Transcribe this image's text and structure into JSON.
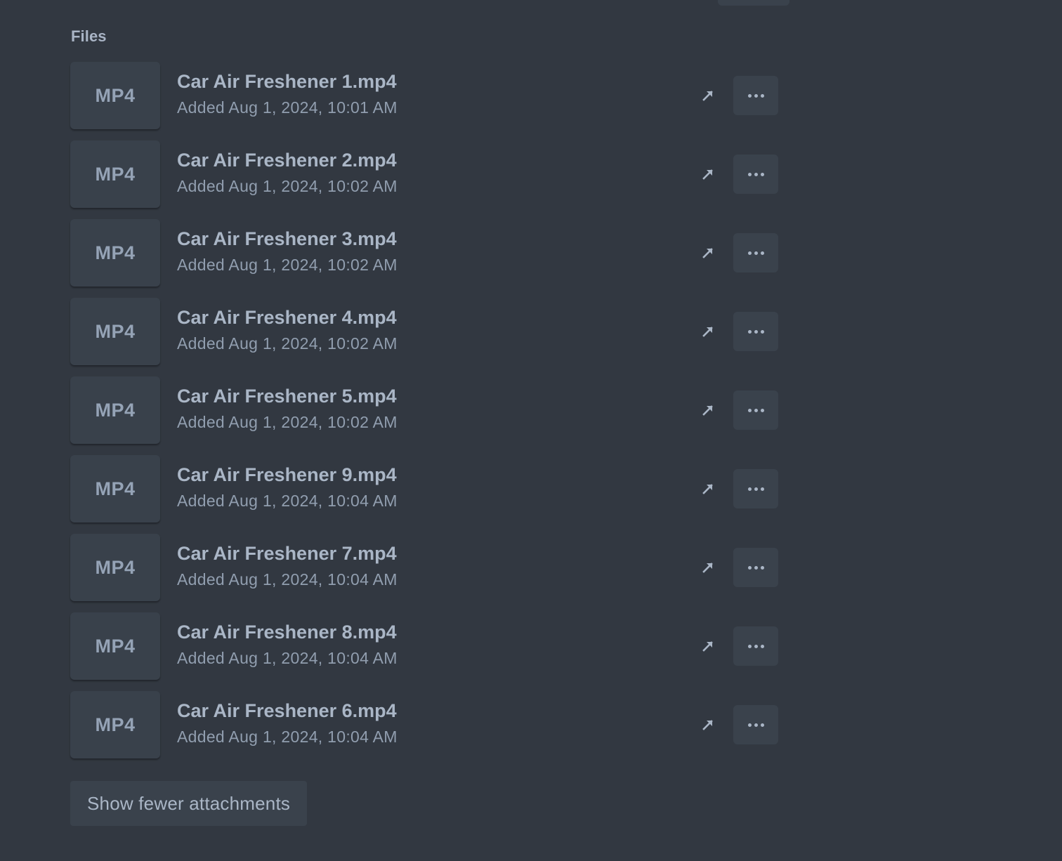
{
  "section": {
    "title": "Files"
  },
  "files": [
    {
      "type_label": "MP4",
      "name": "Car Air Freshener 1.mp4",
      "added": "Added Aug 1, 2024, 10:01 AM"
    },
    {
      "type_label": "MP4",
      "name": "Car Air Freshener 2.mp4",
      "added": "Added Aug 1, 2024, 10:02 AM"
    },
    {
      "type_label": "MP4",
      "name": "Car Air Freshener 3.mp4",
      "added": "Added Aug 1, 2024, 10:02 AM"
    },
    {
      "type_label": "MP4",
      "name": "Car Air Freshener 4.mp4",
      "added": "Added Aug 1, 2024, 10:02 AM"
    },
    {
      "type_label": "MP4",
      "name": "Car Air Freshener 5.mp4",
      "added": "Added Aug 1, 2024, 10:02 AM"
    },
    {
      "type_label": "MP4",
      "name": "Car Air Freshener 9.mp4",
      "added": "Added Aug 1, 2024, 10:04 AM"
    },
    {
      "type_label": "MP4",
      "name": "Car Air Freshener 7.mp4",
      "added": "Added Aug 1, 2024, 10:04 AM"
    },
    {
      "type_label": "MP4",
      "name": "Car Air Freshener 8.mp4",
      "added": "Added Aug 1, 2024, 10:04 AM"
    },
    {
      "type_label": "MP4",
      "name": "Car Air Freshener 6.mp4",
      "added": "Added Aug 1, 2024, 10:04 AM"
    }
  ],
  "row_actions": {
    "open_icon": "arrow-up-right-icon",
    "more_icon": "ellipsis-icon"
  },
  "footer": {
    "toggle_label": "Show fewer attachments"
  },
  "colors": {
    "background": "#323841",
    "surface": "#3a424c",
    "text_primary": "#aab6c6",
    "text_secondary": "#919eaf"
  }
}
